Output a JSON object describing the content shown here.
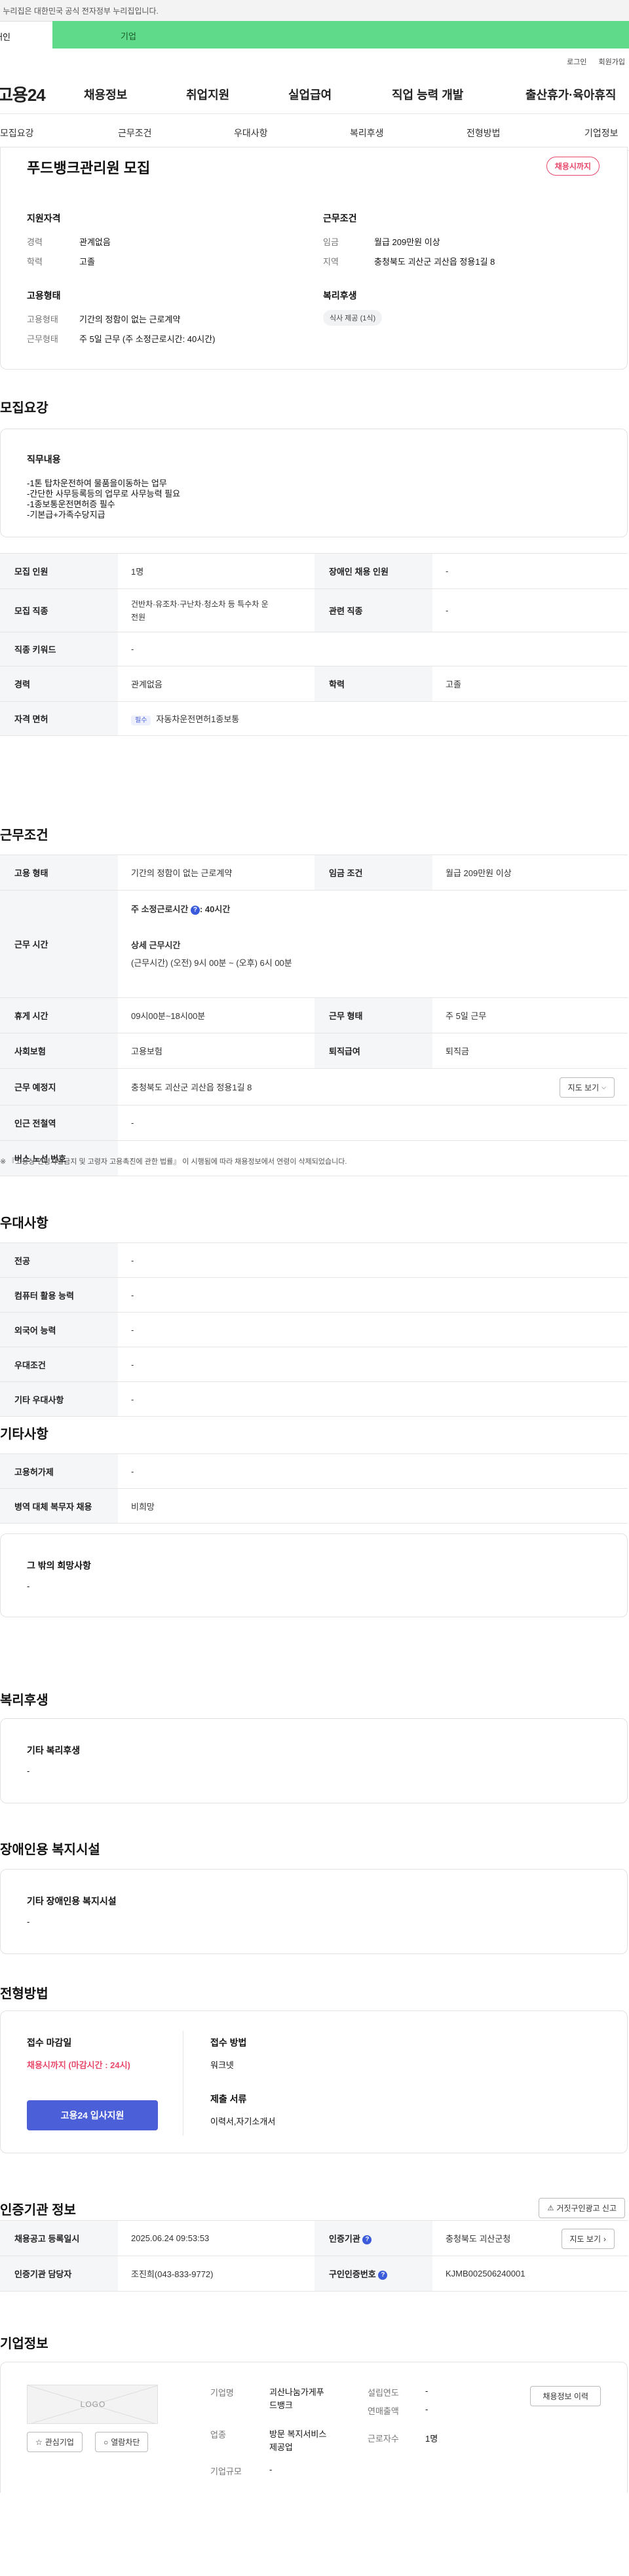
{
  "gov_banner": "이 누리집은 대한민국 공식 전자정부 누리집입니다.",
  "tabs": {
    "individual": "개인",
    "corporate": "기업"
  },
  "util": {
    "login": "로그인",
    "signup": "회원가입"
  },
  "logo": "고용24",
  "main_nav": [
    "채용정보",
    "취업지원",
    "실업급여",
    "직업 능력 개발",
    "출산휴가·육아휴직"
  ],
  "sub_nav": [
    "모집요강",
    "근무조건",
    "우대사항",
    "복리후생",
    "전형방법",
    "기업정보"
  ],
  "job": {
    "title": "푸드뱅크관리원 모집",
    "status": "채용시까지",
    "summary_left_title": "지원자격",
    "career_label": "경력",
    "career": "관계없음",
    "edu_label": "학력",
    "edu": "고졸",
    "employ_title": "고용형태",
    "employ_type_label": "고용형태",
    "employ_type": "기간의 정함이 없는 근로계약",
    "work_type_label": "근무형태",
    "work_type": "주 5일 근무 (주 소정근로시간: 40시간)",
    "cond_title": "근무조건",
    "wage_label": "임금",
    "wage": "월급 209만원 이상",
    "region_label": "지역",
    "region": "충청북도 괴산군 괴산읍 정용1길 8",
    "welfare_title": "복리후생",
    "welfare_tag": "식사 제공 (1식)"
  },
  "recruit": {
    "title": "모집요강",
    "duty_title": "직무내용",
    "duty_lines": [
      "-1톤 탑차운전하여 물품을이동하는 업무",
      "-간단한 사무등록등의 업무로 사무능력 필요",
      "-1종보통운전면허증 필수",
      "-기본급+가족수당지급"
    ],
    "rows": [
      {
        "k1": "모집 인원",
        "v1": "1명",
        "k2": "장애인 채용 인원",
        "v2": "-"
      },
      {
        "k1": "모집 직종",
        "v1a": "건반차·유조차·구난차·청소차 등 특수차 운",
        "v1b": "전원",
        "k2": "관련 직종",
        "v2": "-"
      },
      {
        "k1": "직종 키워드",
        "v1": "-"
      },
      {
        "k1": "경력",
        "v1": "관계없음",
        "k2": "학력",
        "v2": "고졸"
      },
      {
        "k1": "자격 면허",
        "tag": "필수",
        "v1": "자동차운전면허1종보통"
      }
    ]
  },
  "conditions": {
    "title": "근무조건",
    "employ_type_k": "고용 형태",
    "employ_type_v": "기간의 정함이 없는 근로계약",
    "wage_k": "임금 조건",
    "wage_v": "월급 209만원 이상",
    "hours_k": "근무 시간",
    "hours_weekly": "주 소정근로시간",
    "hours_weekly_v": ": 40시간",
    "hours_detail_t": "상세 근무시간",
    "hours_detail_v": "(근무시간) (오전) 9시 00분 ~ (오후) 6시 00분",
    "break_k": "휴게 시간",
    "break_v": "09시00분~18시00분",
    "worktype_k": "근무 형태",
    "worktype_v": "주 5일 근무",
    "insurance_k": "사회보험",
    "insurance_v": "고용보험",
    "retire_k": "퇴직급여",
    "retire_v": "퇴직금",
    "place_k": "근무 예정지",
    "place_v": "충청북도 괴산군 괴산읍 정용1길 8",
    "map_btn": "지도 보기",
    "subway_k": "인근 전철역",
    "subway_v": "-",
    "bus_k": "버스 노선 번호",
    "bus_v": "-",
    "note": "※ 『고용상 연령차별금지 및 고령자 고용촉진에 관한 법률』 이 시행됨에 따라 채용정보에서 연령이 삭제되었습니다."
  },
  "pref": {
    "title": "우대사항",
    "rows": [
      [
        "전공",
        "-"
      ],
      [
        "컴퓨터 활용 능력",
        "-"
      ],
      [
        "외국어 능력",
        "-"
      ],
      [
        "우대조건",
        "-"
      ],
      [
        "기타 우대사항",
        "-"
      ]
    ]
  },
  "etc": {
    "title": "기타사항",
    "rows": [
      [
        "고용허가제",
        "-"
      ],
      [
        "병역 대체 복무자 채용",
        "비희망"
      ]
    ],
    "other_title": "그 밖의 희망사항",
    "other_v": "-"
  },
  "welfare": {
    "title": "복리후생",
    "sub": "기타 복리후생",
    "v": "-"
  },
  "disabled": {
    "title": "장애인용 복지시설",
    "sub": "기타 장애인용 복지시설",
    "v": "-"
  },
  "process": {
    "title": "전형방법",
    "deadline_label": "접수 마감일",
    "deadline_v": "채용시까지 (마감시간 : 24시)",
    "apply_btn": "고용24 입사지원",
    "method_label": "접수 방법",
    "method_v": "워크넷",
    "docs_label": "제출 서류",
    "docs_v": "이력서,자기소개서"
  },
  "agency": {
    "title": "인증기관 정보",
    "report_btn": "거짓구인광고 신고",
    "reg_k": "채용공고 등록일시",
    "reg_v": "2025.06.24 09:53:53",
    "inst_k": "인증기관",
    "inst_v": "충청북도 괴산군청",
    "map_btn": "지도 보기",
    "mgr_k": "인증기관 담당자",
    "mgr_v": "조진희(043-833-9772)",
    "num_k": "구인인증번호",
    "num_v": "KJMB002506240001"
  },
  "company": {
    "title": "기업정보",
    "logo_text": "LOGO",
    "fav_btn": "관심기업",
    "block_btn": "열람차단",
    "name_k": "기업명",
    "name_v1": "괴산나눔가게푸",
    "name_v2": "드뱅크",
    "year_k": "설립연도",
    "year_v": "-",
    "sales_k": "연매출액",
    "sales_v": "-",
    "industry_k": "업종",
    "industry_v1": "방문 복지서비스",
    "industry_v2": "제공업",
    "emp_k": "근로자수",
    "emp_v": "1명",
    "size_k": "기업규모",
    "size_v": "-",
    "history_btn": "채용정보 이력"
  },
  "colors": {
    "accent": "#5fd98a",
    "brand_blue": "#4a5fd8",
    "pink": "#e8486a"
  }
}
